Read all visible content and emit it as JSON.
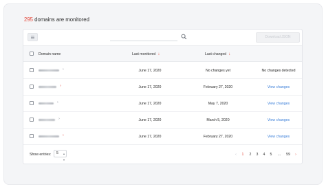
{
  "header": {
    "count": "295",
    "suffix": " domains are monitored"
  },
  "toolbar": {
    "search_placeholder": "",
    "download_label": "Download JSON"
  },
  "table": {
    "columns": {
      "domain": "Domain name",
      "last_monitored": "Last monitored",
      "last_changed": "Last changed",
      "action": ""
    },
    "sort_icon": "arrow-down-icon",
    "rows": [
      {
        "domain": "",
        "last_monitored": "June 17, 2020",
        "last_changed": "No changes yet",
        "action": "No changes detected",
        "action_is_link": false
      },
      {
        "domain": "",
        "last_monitored": "June 17, 2020",
        "last_changed": "February 27, 2020",
        "action": "View changes",
        "action_is_link": true
      },
      {
        "domain": "",
        "last_monitored": "June 17, 2020",
        "last_changed": "May 7, 2020",
        "action": "View changes",
        "action_is_link": true
      },
      {
        "domain": "",
        "last_monitored": "June 17, 2020",
        "last_changed": "March 5, 2020",
        "action": "View changes",
        "action_is_link": true
      },
      {
        "domain": "",
        "last_monitored": "June 17, 2020",
        "last_changed": "February 27, 2020",
        "action": "View changes",
        "action_is_link": true
      }
    ]
  },
  "footer": {
    "show_entries_label": "Show entries:",
    "entries_value": "5",
    "pagination": {
      "prev": "‹",
      "pages": [
        "1",
        "2",
        "3",
        "4",
        "5",
        "...",
        "59"
      ],
      "current": "1",
      "next": "›"
    }
  },
  "colors": {
    "accent": "#e4473a",
    "link": "#3a7ed8"
  }
}
